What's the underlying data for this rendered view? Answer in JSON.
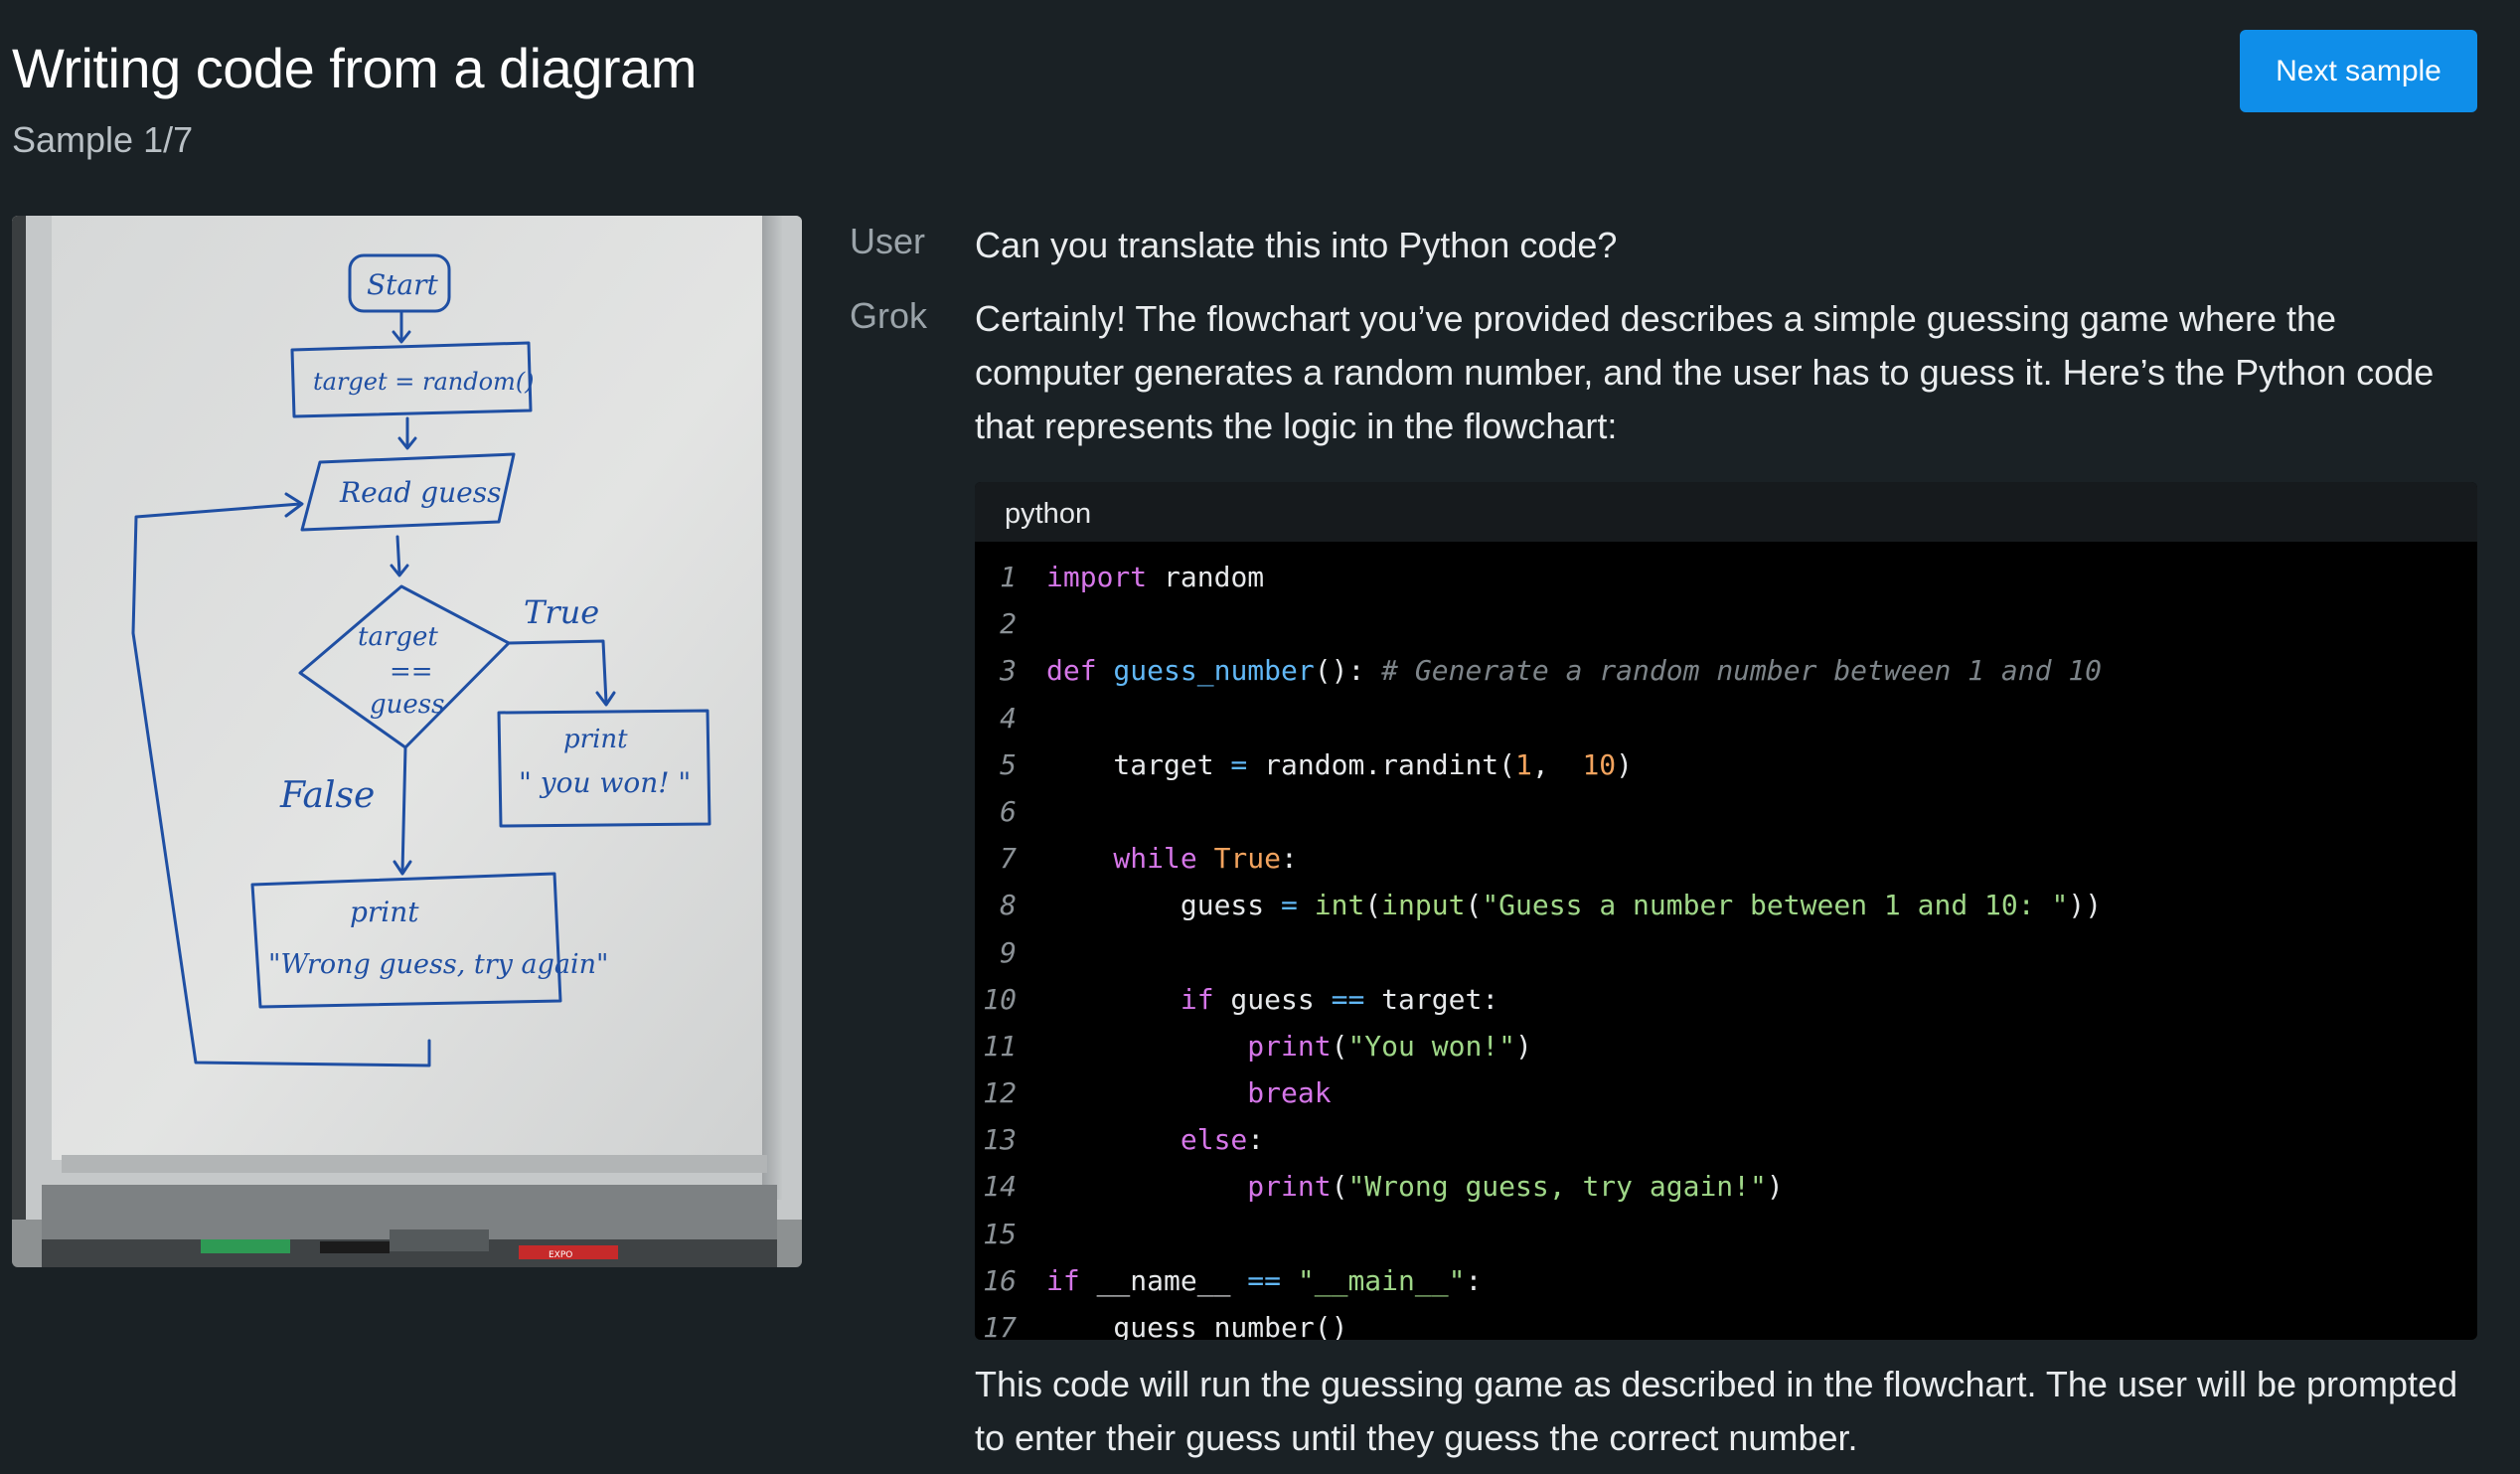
{
  "header": {
    "title": "Writing code from a diagram",
    "sample_count": "Sample 1/7",
    "next_label": "Next sample"
  },
  "whiteboard": {
    "start": "Start",
    "assign": "target = random()",
    "read": "Read guess",
    "cond_top": "target",
    "cond_mid": "==",
    "cond_bot": "guess",
    "true_label": "True",
    "false_label": "False",
    "win_print": "print",
    "win_text": "\" you won! \"",
    "lose_print": "print",
    "lose_text": "\"Wrong guess, try again\"",
    "marker_brand": "EXPO"
  },
  "conversation": {
    "user_label": "User",
    "user_message": "Can you translate this into Python code?",
    "assistant_label": "Grok",
    "assistant_intro": "Certainly! The flowchart you’ve provided describes a simple guessing game where the computer generates a random number, and the user has to guess it. Here’s the Python code that represents the logic in the flowchart:",
    "assistant_outro": "This code will run the guessing game as described in the flowchart. The user will be prompted to enter their guess until they guess the correct number."
  },
  "code": {
    "language": "python",
    "lines": [
      {
        "n": "1",
        "tokens": [
          [
            "kw",
            "import"
          ],
          [
            "",
            "random"
          ]
        ],
        "text": "import random"
      },
      {
        "n": "2",
        "tokens": [],
        "text": ""
      },
      {
        "n": "3",
        "tokens": [
          [
            "kw",
            "def"
          ],
          [
            "fn",
            "guess_number"
          ],
          [
            "",
            "():"
          ],
          [
            "cmt",
            "# Generate a random number between 1 and 10"
          ]
        ],
        "text": "def guess_number(): # Generate a random number between 1 and 10"
      },
      {
        "n": "4",
        "tokens": [],
        "text": ""
      },
      {
        "n": "5",
        "tokens": [
          [
            "",
            "    target"
          ],
          [
            "op",
            "="
          ],
          [
            "",
            "random.randint("
          ],
          [
            "num",
            "1"
          ],
          [
            "",
            ", "
          ],
          [
            "num",
            "10"
          ],
          [
            "",
            ")"
          ]
        ],
        "text": "    target = random.randint(1, 10)"
      },
      {
        "n": "6",
        "tokens": [],
        "text": ""
      },
      {
        "n": "7",
        "tokens": [
          [
            "kw",
            "    while"
          ],
          [
            "const",
            "True"
          ],
          [
            "",
            ":"
          ]
        ],
        "text": "    while True:"
      },
      {
        "n": "8",
        "tokens": [
          [
            "",
            "        guess"
          ],
          [
            "op",
            "="
          ],
          [
            "bi",
            "int"
          ],
          [
            "",
            "("
          ],
          [
            "bi",
            "input"
          ],
          [
            "",
            "("
          ],
          [
            "str",
            "\"Guess a number between 1 and 10: \""
          ],
          [
            "",
            "))"
          ]
        ],
        "text": "        guess = int(input(\"Guess a number between 1 and 10: \"))"
      },
      {
        "n": "9",
        "tokens": [],
        "text": ""
      },
      {
        "n": "10",
        "tokens": [
          [
            "kw",
            "        if"
          ],
          [
            "",
            "guess"
          ],
          [
            "op",
            "=="
          ],
          [
            "",
            "target:"
          ]
        ],
        "text": "        if guess == target:"
      },
      {
        "n": "11",
        "tokens": [
          [
            "kw",
            "            print"
          ],
          [
            "",
            "("
          ],
          [
            "str",
            "\"You won!\""
          ],
          [
            "",
            ")"
          ]
        ],
        "text": "            print(\"You won!\")"
      },
      {
        "n": "12",
        "tokens": [
          [
            "kw",
            "            break"
          ]
        ],
        "text": "            break"
      },
      {
        "n": "13",
        "tokens": [
          [
            "kw",
            "        else"
          ],
          [
            "",
            ":"
          ]
        ],
        "text": "        else:"
      },
      {
        "n": "14",
        "tokens": [
          [
            "kw",
            "            print"
          ],
          [
            "",
            "("
          ],
          [
            "str",
            "\"Wrong guess, try again!\""
          ],
          [
            "",
            ")"
          ]
        ],
        "text": "            print(\"Wrong guess, try again!\")"
      },
      {
        "n": "15",
        "tokens": [],
        "text": ""
      },
      {
        "n": "16",
        "tokens": [
          [
            "kw",
            "if"
          ],
          [
            "",
            "__name__"
          ],
          [
            "op",
            "=="
          ],
          [
            "str",
            "\"__main__\""
          ],
          [
            "",
            ":"
          ]
        ],
        "text": "if __name__ == \"__main__\":"
      },
      {
        "n": "17",
        "tokens": [
          [
            "",
            "    guess_number()"
          ]
        ],
        "text": "    guess_number()"
      }
    ]
  }
}
